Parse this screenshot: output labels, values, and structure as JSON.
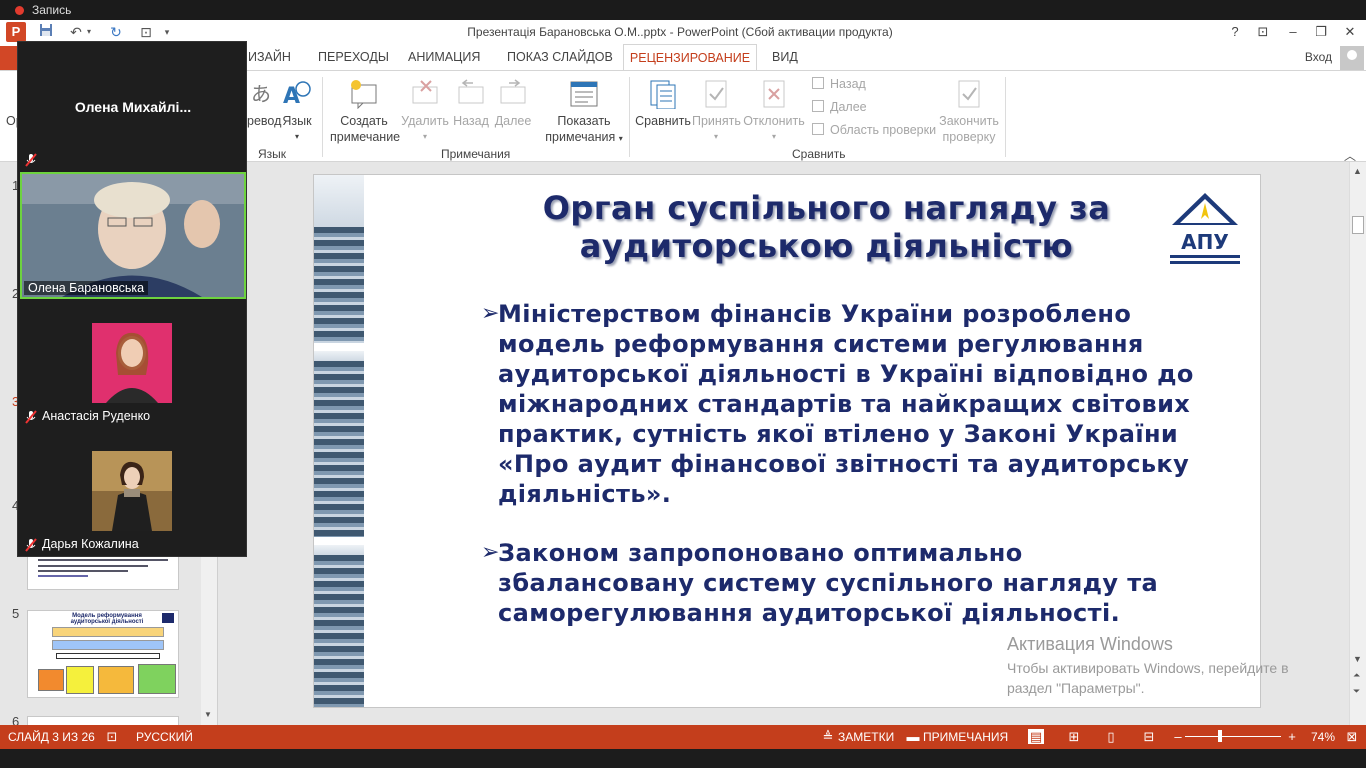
{
  "recording": {
    "label": "Запись"
  },
  "window": {
    "title": "Презентація Барановська О.М..pptx - PowerPoint (Сбой активации продукта)",
    "app_letter": "P",
    "controls": [
      "?",
      "⊡",
      "–",
      "❐",
      "✕"
    ]
  },
  "tabs": {
    "items": [
      "ИЗАЙН",
      "ПЕРЕХОДЫ",
      "АНИМАЦИЯ",
      "ПОКАЗ СЛАЙДОВ"
    ],
    "active": "РЕЦЕНЗИРОВАНИЕ",
    "after": "ВИД",
    "signin": "Вход",
    "left_cut": "Ор"
  },
  "ribbon": {
    "lang": {
      "translate": "ревод",
      "language": "Язык",
      "group": "Язык"
    },
    "comments": {
      "create": [
        "Создать",
        "примечание"
      ],
      "delete": "Удалить",
      "back": "Назад",
      "next": "Далее",
      "show": [
        "Показать",
        "примечания"
      ],
      "group": "Примечания"
    },
    "compare": {
      "compare": "Сравнить",
      "accept": "Принять",
      "reject": "Отклонить",
      "prev": "Назад",
      "next": "Далее",
      "pane": "Область проверки",
      "finish": [
        "Закончить",
        "проверку"
      ],
      "group": "Сравнить"
    }
  },
  "thumbs": {
    "numbers": [
      "1",
      "2",
      "3",
      "4",
      "5",
      "6"
    ],
    "slide5_title": "Модель реформування аудиторської діяльності"
  },
  "slide": {
    "title": "Орган суспільного нагляду за аудиторською діяльністю",
    "logo_text": "АПУ",
    "bullet_mark": "➢",
    "bullets": [
      "Міністерством фінансів України розроблено модель реформування системи регулювання аудиторської діяльності в Україні відповідно до міжнародних стандартів та найкращих світових практик, сутність якої втілено у Законі України «Про аудит фінансової звітності та аудиторську діяльність».",
      "Законом запропоновано оптимально збалансовану систему суспільного нагляду та саморегулювання аудиторської діяльності."
    ]
  },
  "watermark": {
    "line1": "Активация Windows",
    "line2": "Чтобы активировать Windows, перейдите в раздел \"Параметры\"."
  },
  "statusbar": {
    "slide_info": "СЛАЙД 3 ИЗ 26",
    "language": "РУССКИЙ",
    "notes": "ЗАМЕТКИ",
    "comments": "ПРИМЕЧАНИЯ",
    "zoom": "74%"
  },
  "zoom_call": {
    "top_name": "Олена  Михайлі...",
    "participants": [
      {
        "name": "Олена Барановська",
        "muted": false
      },
      {
        "name": "Анастасія Руденко",
        "muted": true
      },
      {
        "name": "Дарья Кожалина",
        "muted": true
      }
    ]
  },
  "colors": {
    "accent": "#c43e1c",
    "title_text": "#1d2a6b",
    "active_speaker": "#6dd33f"
  }
}
